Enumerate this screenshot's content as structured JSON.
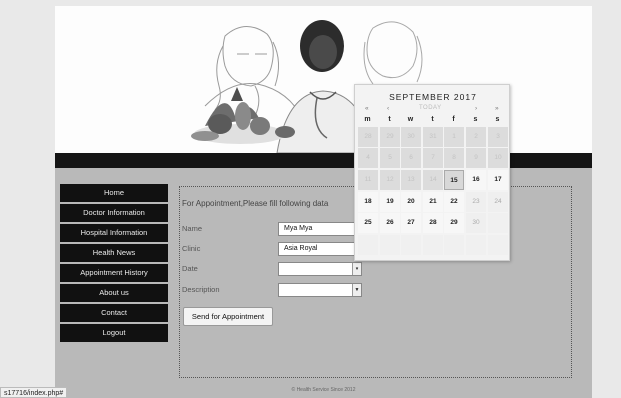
{
  "sidebar": {
    "items": [
      {
        "label": "Home"
      },
      {
        "label": "Doctor Information"
      },
      {
        "label": "Hospital Information"
      },
      {
        "label": "Health News"
      },
      {
        "label": "Appointment History"
      },
      {
        "label": "About us"
      },
      {
        "label": "Contact"
      },
      {
        "label": "Logout"
      }
    ]
  },
  "form": {
    "title": "For Appointment,Please fill following data",
    "name_label": "Name",
    "name_value": "Mya Mya",
    "clinic_label": "Clinic",
    "clinic_value": "Asia Royal",
    "date_label": "Date",
    "date_value": "",
    "description_label": "Description",
    "description_value": "",
    "send_label": "Send for Appointment"
  },
  "calendar": {
    "title": "SEPTEMBER 2017",
    "prev_year": "«",
    "prev_month": "‹",
    "today_label": "TODAY",
    "next_month": "›",
    "next_year": "»",
    "weekdays": [
      "m",
      "t",
      "w",
      "t",
      "f",
      "s",
      "s"
    ],
    "weeks": [
      [
        "28",
        "29",
        "30",
        "31",
        "1",
        "2",
        "3"
      ],
      [
        "4",
        "5",
        "6",
        "7",
        "8",
        "9",
        "10"
      ],
      [
        "11",
        "12",
        "13",
        "14",
        "15",
        "16",
        "17"
      ],
      [
        "18",
        "19",
        "20",
        "21",
        "22",
        "23",
        "24"
      ],
      [
        "25",
        "26",
        "27",
        "28",
        "29",
        "30",
        ""
      ],
      [
        "",
        "",
        "",
        "",
        "",
        "",
        ""
      ]
    ],
    "today_day": "15"
  },
  "footer": {
    "text": "© Health Service Since 2012"
  },
  "status_bar": {
    "url": "s17716/index.php#"
  }
}
